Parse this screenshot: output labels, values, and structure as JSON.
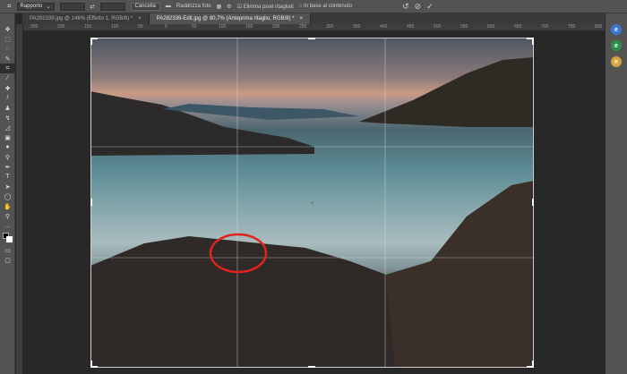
{
  "options_bar": {
    "ratio": "Rapporto",
    "clear": "Cancella",
    "straighten": "Raddrizza foto",
    "delete_cropped": "Elimina pixel ritagliati",
    "content_aware": "In base al contenuto"
  },
  "tabs": [
    {
      "label": "PA282339.jpg @ 146% (Effetto 1, RGB/8) *"
    },
    {
      "label": "PA282339-Edit.jpg @ 80,7% (Anteprima ritaglio, RGB/8) *"
    }
  ],
  "ruler": [
    "250",
    "200",
    "150",
    "100",
    "50",
    "0",
    "50",
    "100",
    "150",
    "200",
    "250",
    "300",
    "350",
    "400",
    "450",
    "500",
    "550",
    "600",
    "650",
    "700",
    "750",
    "800"
  ],
  "tools": [
    "move",
    "marquee",
    "lasso",
    "quick-select",
    "crop",
    "eyedropper",
    "healing",
    "brush",
    "stamp",
    "history-brush",
    "eraser",
    "gradient",
    "blur",
    "dodge",
    "pen",
    "type",
    "path-select",
    "shape",
    "hand",
    "zoom",
    "more"
  ],
  "colors": {
    "annotation": "#e0231c",
    "panel": "#535353",
    "canvas": "#282828"
  }
}
